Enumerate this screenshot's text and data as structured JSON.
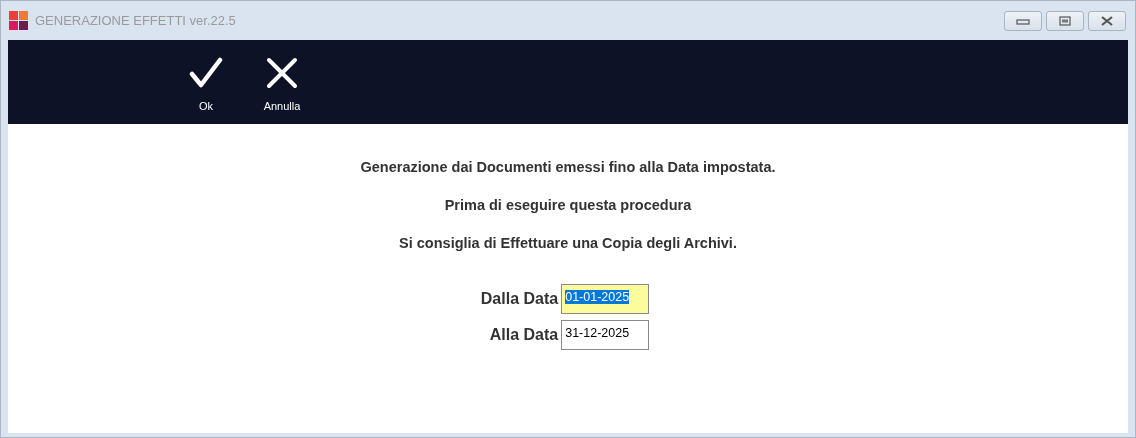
{
  "window": {
    "title": "GENERAZIONE EFFETTI ver.22.5"
  },
  "toolbar": [
    {
      "kind": "ok",
      "label": "Ok"
    },
    {
      "kind": "cancel",
      "label": "Annulla"
    }
  ],
  "messages": [
    "Generazione dai Documenti emessi fino alla Data impostata.",
    "Prima di eseguire questa procedura",
    "Si consiglia di Effettuare una Copia degli Archivi."
  ],
  "fields": [
    {
      "label": "Dalla Data",
      "value": "01-01-2025",
      "focused": true
    },
    {
      "label": "Alla Data",
      "value": "31-12-2025",
      "focused": false
    }
  ]
}
